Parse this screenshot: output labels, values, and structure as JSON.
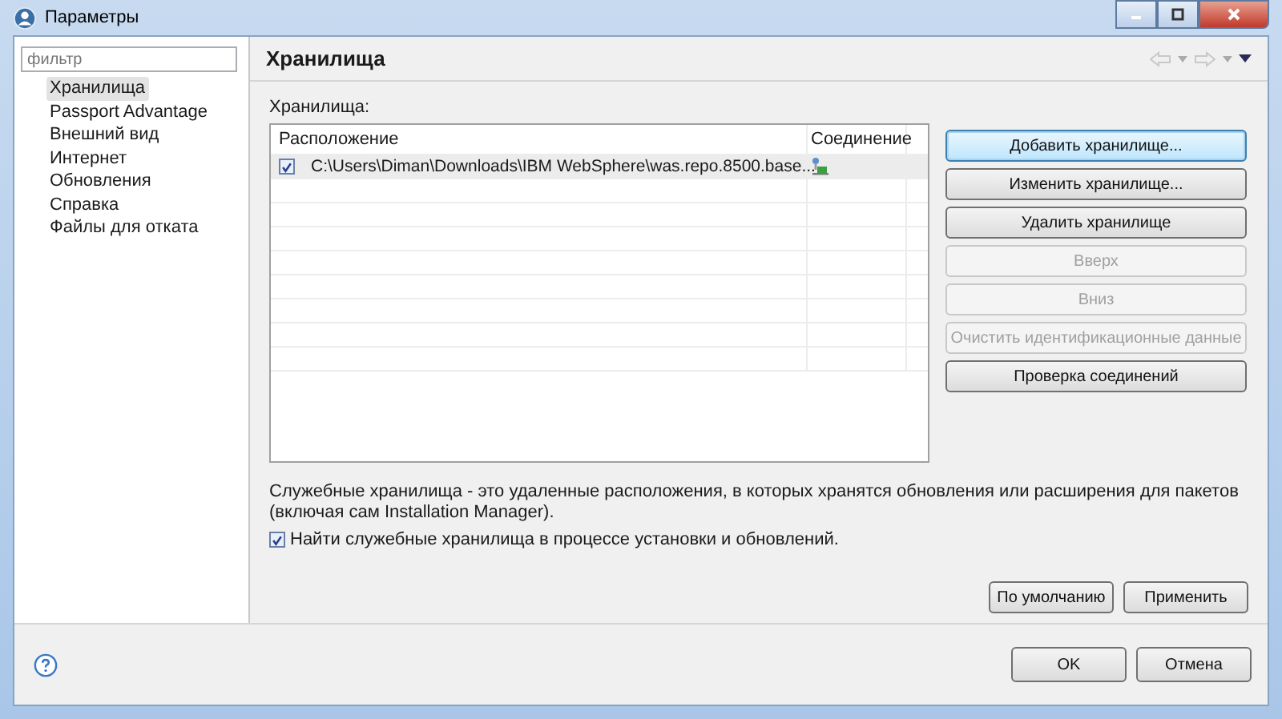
{
  "window": {
    "title": "Параметры"
  },
  "sidebar": {
    "filter": {
      "placeholder": "фильтр"
    },
    "items": [
      {
        "label": "Хранилища",
        "selected": true
      },
      {
        "label": "Passport Advantage",
        "selected": false
      },
      {
        "label": "Внешний вид",
        "selected": false
      },
      {
        "label": "Интернет",
        "selected": false
      },
      {
        "label": "Обновления",
        "selected": false
      },
      {
        "label": "Справка",
        "selected": false
      },
      {
        "label": "Файлы для отката",
        "selected": false
      }
    ]
  },
  "page": {
    "title": "Хранилища",
    "list_label": "Хранилища:",
    "table": {
      "columns": [
        "Расположение",
        "Соединение"
      ],
      "rows": [
        {
          "checked": true,
          "location": "C:\\Users\\Diman\\Downloads\\IBM WebSphere\\was.repo.8500.base..."
        }
      ]
    },
    "buttons": [
      {
        "label": "Добавить хранилище...",
        "disabled": false,
        "focused": true
      },
      {
        "label": "Изменить хранилище...",
        "disabled": false,
        "focused": false
      },
      {
        "label": "Удалить хранилище",
        "disabled": false,
        "focused": false
      },
      {
        "label": "Вверх",
        "disabled": true,
        "focused": false
      },
      {
        "label": "Вниз",
        "disabled": true,
        "focused": false
      },
      {
        "label": "Очистить идентификационные данные",
        "disabled": true,
        "focused": false
      },
      {
        "label": "Проверка соединений",
        "disabled": false,
        "focused": false
      }
    ],
    "description": "Служебные хранилища - это удаленные расположения, в которых хранятся обновления или расширения для пакетов (включая сам Installation Manager).",
    "search_option": {
      "label": "Найти служебные хранилища в процессе установки и обновлений.",
      "checked": true
    },
    "page_buttons": [
      "По умолчанию",
      "Применить"
    ]
  },
  "dialog_buttons": [
    "OK",
    "Отмена"
  ]
}
